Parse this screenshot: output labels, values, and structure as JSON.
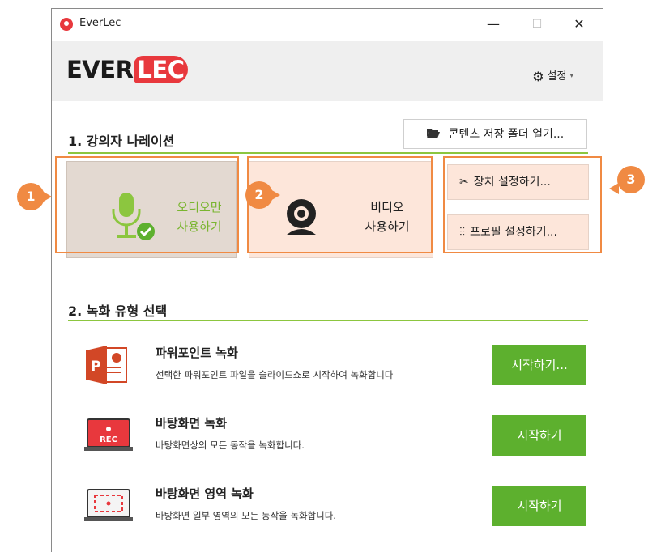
{
  "window": {
    "title": "EverLec",
    "minimize": "—",
    "maximize": "☐",
    "close": "✕"
  },
  "header": {
    "logo_part1": "EVER",
    "logo_part2": "LEC",
    "settings_label": "설정",
    "settings_caret": "▾"
  },
  "section1": {
    "title": "1. 강의자 나레이션",
    "folder_button": "콘텐츠 저장 폴더 열기...",
    "audio_card": {
      "line1": "오디오만",
      "line2": "사용하기"
    },
    "video_card": {
      "line1": "비디오",
      "line2": "사용하기"
    },
    "device_button": "장치 설정하기...",
    "profile_button": "프로필 설정하기..."
  },
  "section2": {
    "title": "2. 녹화 유형 선택",
    "items": [
      {
        "title": "파워포인트 녹화",
        "desc": "선택한 파워포인트 파일을 슬라이드쇼로 시작하여 녹화합니다",
        "button": "시작하기..."
      },
      {
        "title": "바탕화면 녹화",
        "desc": "바탕화면상의 모든 동작을 녹화합니다.",
        "button": "시작하기",
        "icon_text": "REC"
      },
      {
        "title": "바탕화면 영역 녹화",
        "desc": "바탕화면 일부 영역의 모든 동작을 녹화합니다.",
        "button": "시작하기"
      }
    ]
  },
  "callouts": {
    "one": "1",
    "two": "2",
    "three": "3"
  },
  "colors": {
    "accent_green": "#5db02e",
    "line_green": "#8cc63f",
    "highlight_orange": "#f08a43",
    "brand_red": "#e8383d"
  }
}
